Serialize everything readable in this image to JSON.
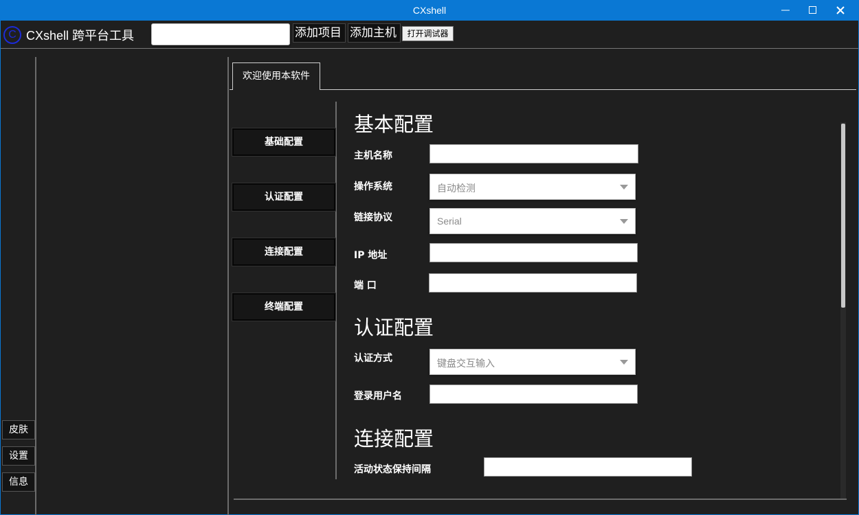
{
  "window": {
    "title": "CXshell"
  },
  "toolbar": {
    "logo_glyph": "C",
    "app_title": "CXshell 跨平台工具",
    "search_value": "",
    "add_item_label": "添加项目",
    "add_host_label": "添加主机",
    "open_debugger_label": "打开调试器"
  },
  "leftbar": {
    "skin_label": "皮肤",
    "settings_label": "设置",
    "info_label": "信息"
  },
  "tabs": [
    {
      "label": "欢迎使用本软件"
    }
  ],
  "nav": {
    "basic": "基础配置",
    "auth": "认证配置",
    "connection": "连接配置",
    "terminal": "终端配置"
  },
  "form": {
    "basic_title": "基本配置",
    "hostname_label": "主机名称",
    "hostname_value": "",
    "os_label": "操作系统",
    "os_value": "自动检测",
    "protocol_label": "链接协议",
    "protocol_value": "Serial",
    "ip_label": "IP 地址",
    "ip_value": "",
    "port_label": "端 口",
    "port_value": "",
    "auth_title": "认证配置",
    "auth_method_label": "认证方式",
    "auth_method_value": "键盘交互输入",
    "login_user_label": "登录用户名",
    "login_user_value": "",
    "conn_title": "连接配置",
    "keepalive_label": "活动状态保持间隔",
    "keepalive_value": ""
  },
  "colors": {
    "titlebar": "#0a78d4",
    "background": "#1f1f1f",
    "logo": "#1c2bd6"
  }
}
